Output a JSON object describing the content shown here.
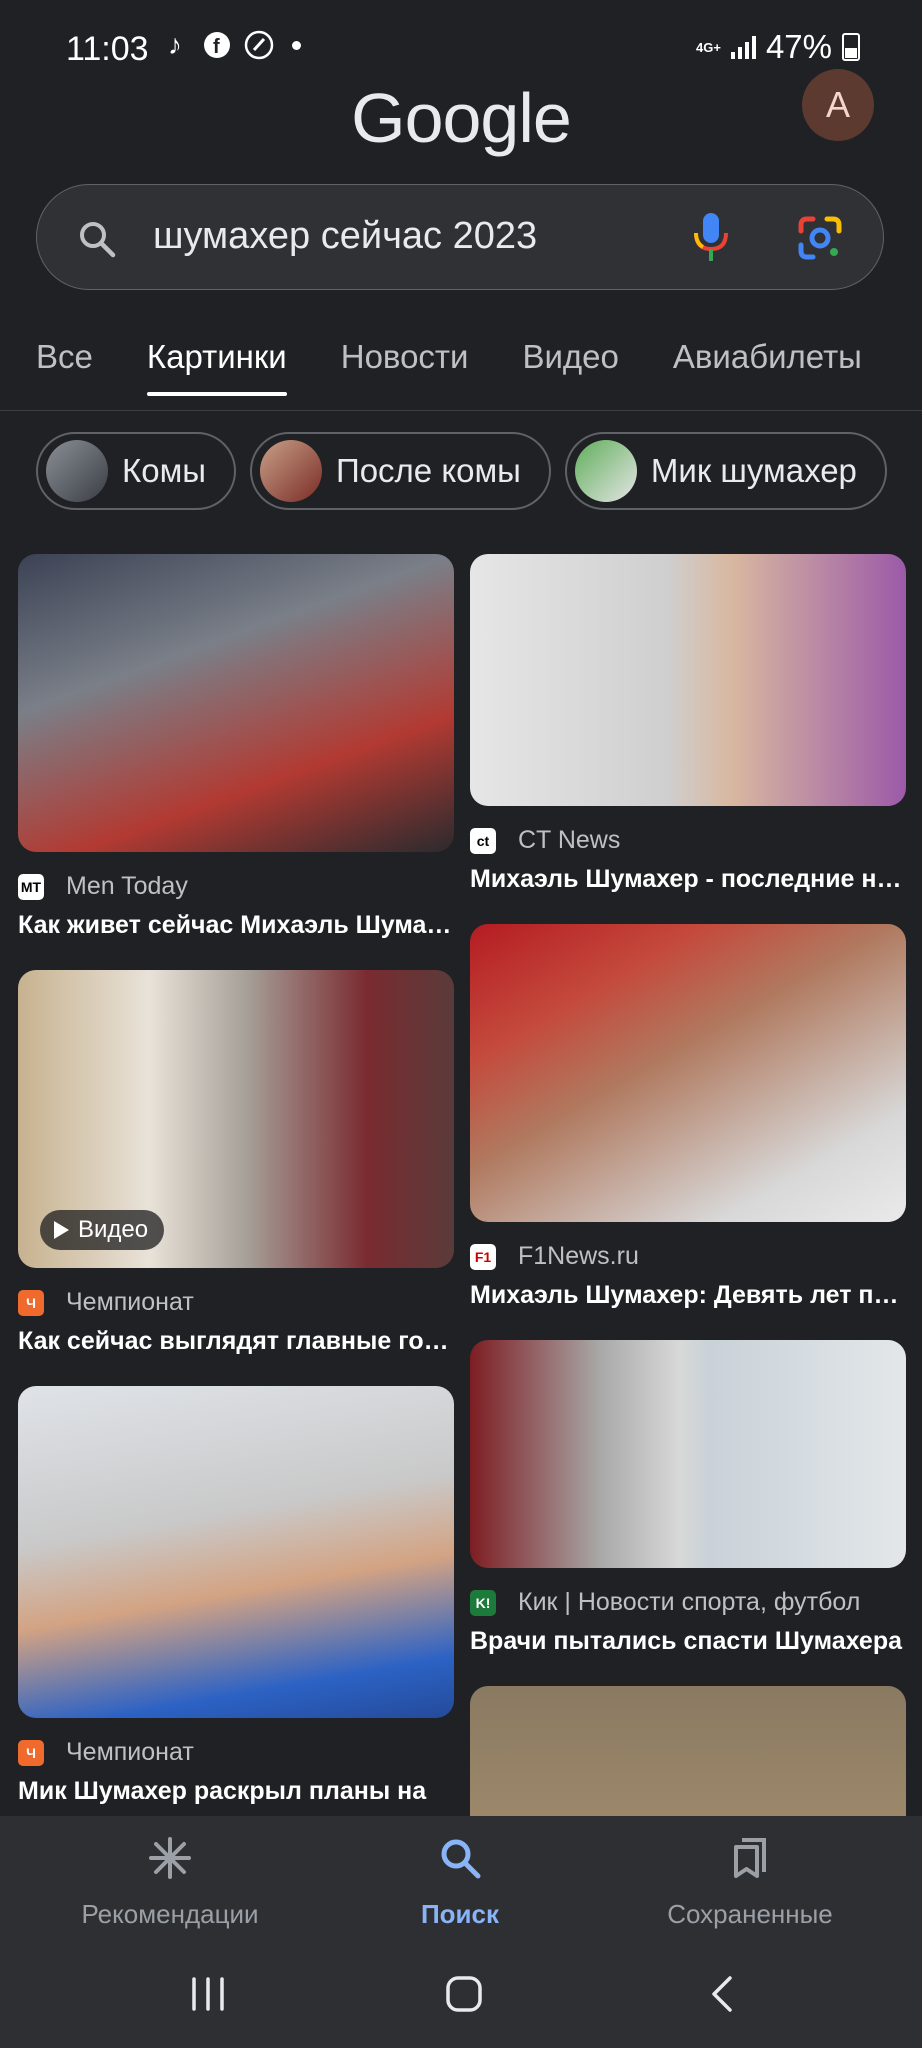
{
  "status_bar": {
    "time": "11:03",
    "network": "4G+",
    "battery": "47%"
  },
  "header": {
    "logo": "Google",
    "avatar_letter": "A"
  },
  "search": {
    "query": "шумахер сейчас 2023"
  },
  "tabs": [
    {
      "label": "Все",
      "active": false
    },
    {
      "label": "Картинки",
      "active": true
    },
    {
      "label": "Новости",
      "active": false
    },
    {
      "label": "Видео",
      "active": false
    },
    {
      "label": "Авиабилеты",
      "active": false
    }
  ],
  "chips": [
    {
      "label": "Комы"
    },
    {
      "label": "После комы"
    },
    {
      "label": "Мик шумахер"
    }
  ],
  "results": [
    {
      "source": "Men Today",
      "title": "Как живет сейчас Михаэль Шумахер",
      "favicon": "MT"
    },
    {
      "source": "CT News",
      "title": "Михаэль Шумахер - последние новости",
      "favicon": "ct"
    },
    {
      "source": "Чемпионат",
      "title": "Как сейчас выглядят главные гонщики",
      "favicon": "Ч",
      "badge": "Видео"
    },
    {
      "source": "F1News.ru",
      "title": "Михаэль Шумахер: Девять лет после",
      "favicon": "F1"
    },
    {
      "source": "Чемпионат",
      "title": "Мик Шумахер раскрыл планы на",
      "favicon": "Ч"
    },
    {
      "source": "Кик | Новости спорта, футбол",
      "title": "Врачи пытались спасти Шумахера",
      "favicon": "K!"
    }
  ],
  "bottom_nav": [
    {
      "label": "Рекомендации",
      "active": false
    },
    {
      "label": "Поиск",
      "active": true
    },
    {
      "label": "Сохраненные",
      "active": false
    }
  ],
  "colors": {
    "background": "#202124",
    "accent": "#8ab4f8"
  }
}
